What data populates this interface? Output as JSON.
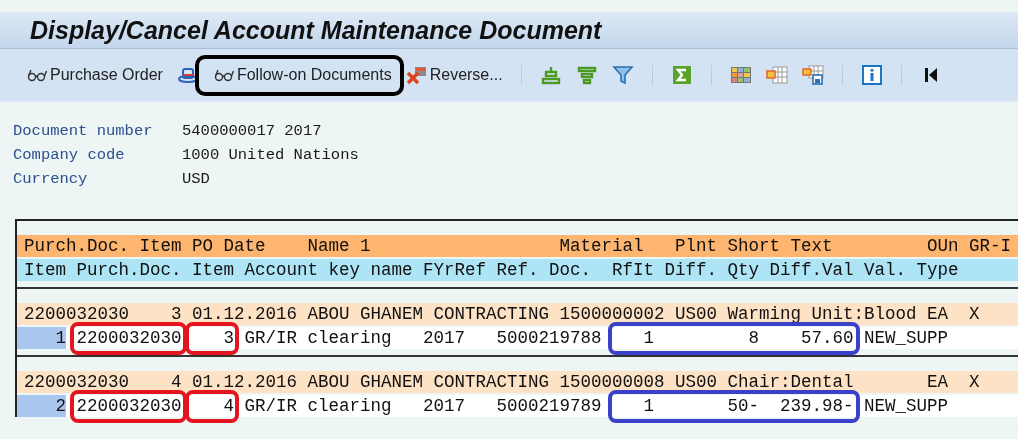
{
  "window": {
    "title": "Display/Cancel Account Maintenance Document"
  },
  "toolbar": {
    "buttons": [
      {
        "label": "Purchase Order",
        "kind": "glasses"
      },
      {
        "label": "Follow-on Documents",
        "kind": "glasses",
        "color": "#000000"
      },
      {
        "label": "Reverse...",
        "kind": "reverse"
      }
    ]
  },
  "header_fields": [
    {
      "label": "Document number",
      "value": "5400000017 2017"
    },
    {
      "label": "Company code",
      "value": "1000 United Nations"
    },
    {
      "label": "Currency",
      "value": "USD"
    }
  ],
  "table": {
    "header_row_1": [
      "Purch.Doc.",
      "Item",
      "PO Date",
      "Name 1",
      "Material",
      "Plnt",
      "Short Text",
      "OUn",
      "GR-I"
    ],
    "header_row_2": [
      "Item",
      "Purch.Doc.",
      "Item",
      "Account key name",
      "FYrRef",
      "Ref. Doc.",
      "RfIt",
      "Diff.",
      "Qty",
      "Diff.Val",
      "Val.",
      "Type"
    ],
    "items": [
      {
        "main": [
          "2200032030",
          "3",
          "01.12.2016",
          "ABOU GHANEM CONTRACTING",
          "1500000002",
          "US00",
          "Warming Unit:Blood",
          "EA",
          "X"
        ],
        "detail": {
          "index": "1",
          "purch_doc": {
            "text": "2200032030",
            "color": "#e4151f"
          },
          "item": {
            "text": "3",
            "color": "#e4151f"
          },
          "account": "GR/IR clearing",
          "fyrref": "2017",
          "ref_doc": "5000219788",
          "diff": {
            "color": "#3b40c8",
            "rfit": "1",
            "qty": "8",
            "value": "57.60"
          },
          "val_type": "NEW_SUPP"
        }
      },
      {
        "main": [
          "2200032030",
          "4",
          "01.12.2016",
          "ABOU GHANEM CONTRACTING",
          "1500000008",
          "US00",
          "Chair:Dental",
          "EA",
          "X"
        ],
        "detail": {
          "index": "2",
          "purch_doc": {
            "text": "2200032030",
            "color": "#e4151f"
          },
          "item": {
            "text": "4",
            "color": "#e4151f"
          },
          "account": "GR/IR clearing",
          "fyrref": "2017",
          "ref_doc": "5000219789",
          "diff": {
            "color": "#3b40c8",
            "rfit": "1",
            "qty": "50-",
            "value": "239.98-"
          },
          "val_type": "NEW_SUPP"
        }
      }
    ]
  }
}
